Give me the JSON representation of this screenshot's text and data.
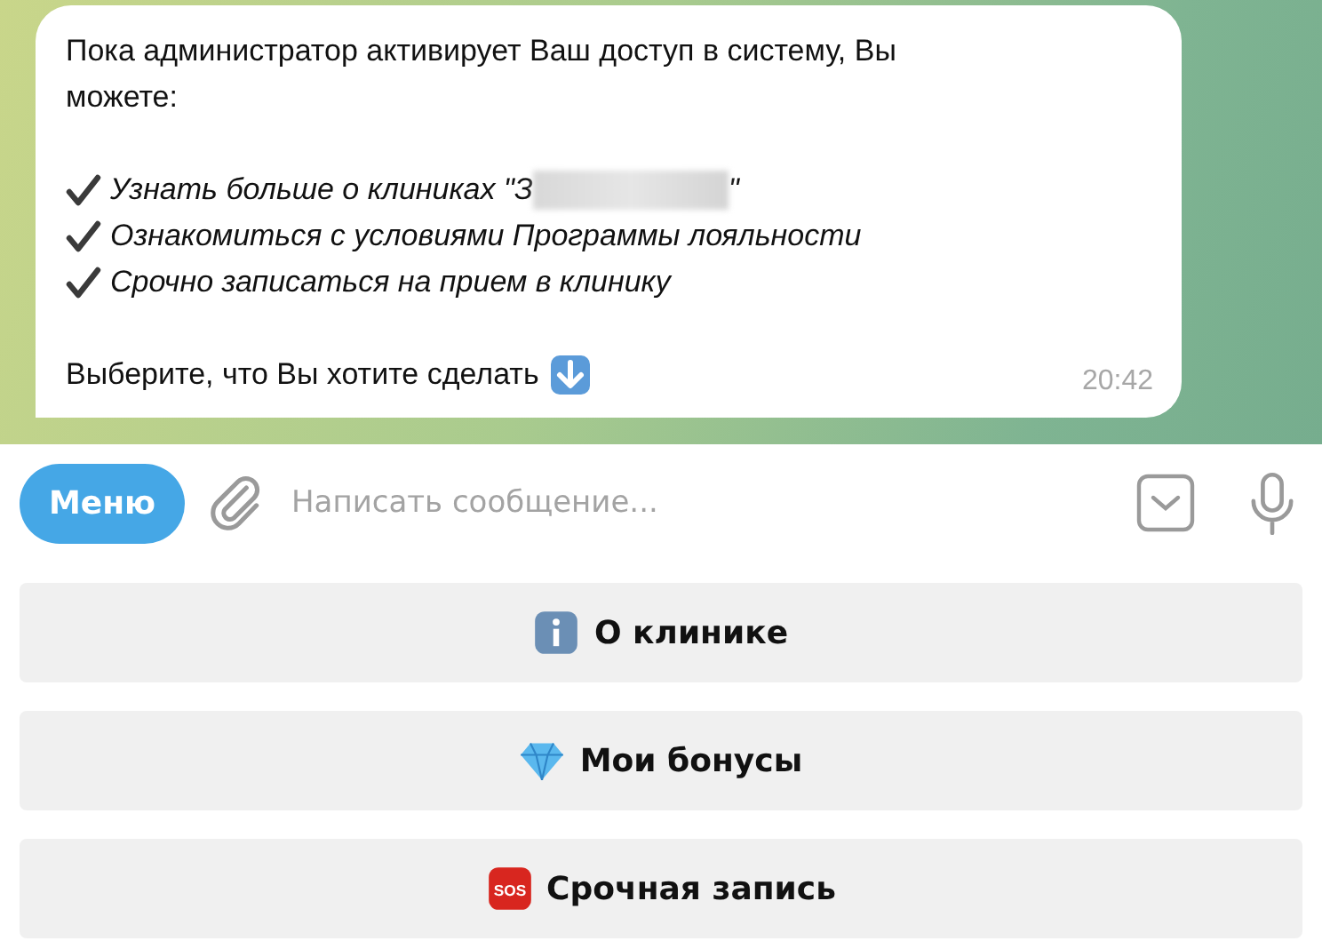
{
  "message": {
    "intro": "Пока администратор активирует Ваш доступ в систему, Вы можете:",
    "items": [
      {
        "text": "Узнать больше о клиниках \"З",
        "redacted": true,
        "after": "\""
      },
      {
        "text": "Ознакомиться с условиями Программы лояльности",
        "redacted": false
      },
      {
        "text": "Срочно записаться на прием в клинику",
        "redacted": false
      }
    ],
    "closing": "Выберите, что Вы хотите сделать",
    "time": "20:42"
  },
  "composer": {
    "menu_button": "Меню",
    "placeholder": "Написать сообщение..."
  },
  "keyboard": [
    {
      "kind": "info",
      "label": "О клинике"
    },
    {
      "kind": "gem",
      "label": "Мои бонусы"
    },
    {
      "kind": "sos",
      "label": "Срочная запись",
      "icon_text": "SOS"
    }
  ]
}
